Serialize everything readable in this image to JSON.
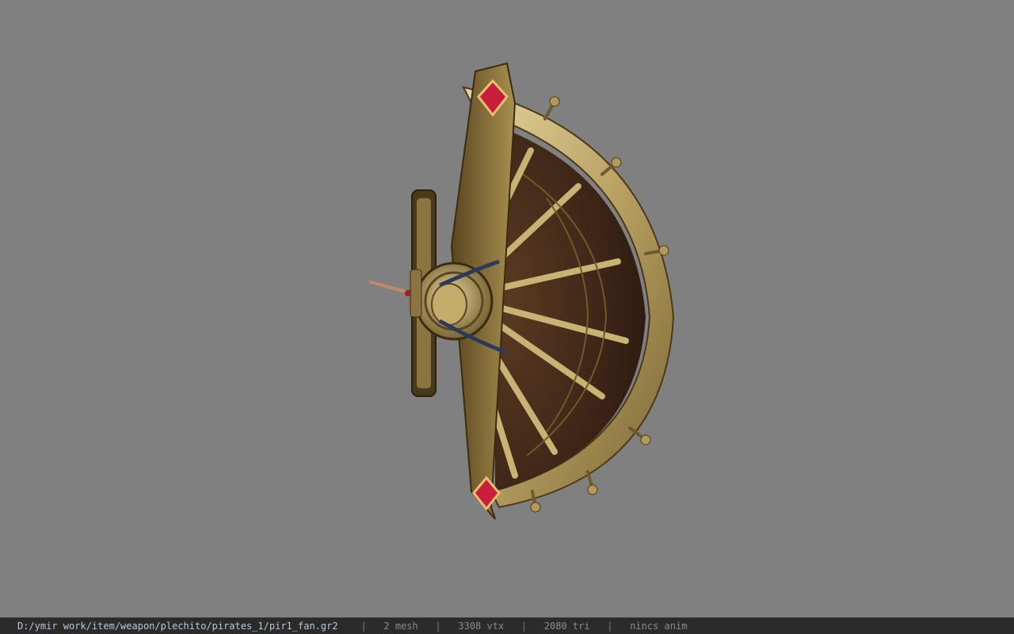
{
  "viewer": {
    "background_color": "#808080",
    "model_icon": "golden-fan-weapon-model",
    "status_bar": {
      "file_path": "D:/ymir work/item/weapon/plechito/pirates_1/pir1_fan.gr2",
      "separator": "|",
      "mesh_count": "2 mesh",
      "vertex_count": "3308 vtx",
      "triangle_count": "2080 tri",
      "anim_status": "nincs anim"
    }
  }
}
